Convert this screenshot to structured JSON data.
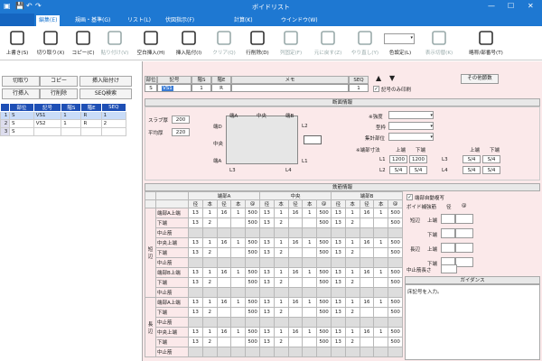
{
  "window": {
    "title": "ボイドリスト"
  },
  "menu": {
    "file": "",
    "tabs": [
      "編集(E)",
      "規画・基準(G)",
      "リスト(L)",
      "伏図指示(F)",
      "計算(K)",
      "ウインドウ(W)"
    ]
  },
  "ribbon": [
    {
      "label": "上書き(S)",
      "icon": "save-icon",
      "dis": false
    },
    {
      "label": "切り取り(X)",
      "icon": "cut-icon",
      "dis": false
    },
    {
      "label": "コピー(C)",
      "icon": "copy-icon",
      "dis": false
    },
    {
      "label": "貼り付け(V)",
      "icon": "paste-icon",
      "dis": true
    },
    {
      "label": "空白挿入(H)",
      "icon": "insert-blank-icon",
      "dis": false
    },
    {
      "label": "挿入貼付(I)",
      "icon": "insert-paste-icon",
      "dis": false
    },
    {
      "label": "クリア(Q)",
      "icon": "clear-icon",
      "dis": true
    },
    {
      "label": "行削除(D)",
      "icon": "delete-row-icon",
      "dis": false
    },
    {
      "label": "列固定(F)",
      "icon": "freeze-column-icon",
      "dis": true
    },
    {
      "label": "元に戻す(Z)",
      "icon": "undo-icon",
      "dis": true
    },
    {
      "label": "やり直し(Y)",
      "icon": "redo-icon",
      "dis": true
    },
    {
      "label": "色設定(L)",
      "icon": "color-setting-icon",
      "dis": false
    },
    {
      "label": "表示切替(K)",
      "icon": "display-toggle-icon",
      "dis": true
    },
    {
      "label": "略称/部番号(T)",
      "icon": "abbreviation-icon",
      "dis": false
    }
  ],
  "leftbuttons": [
    "切取り",
    "コピー",
    "挿入貼付け",
    "行挿入",
    "行削除",
    "SEQ検索"
  ],
  "list": {
    "headers": [
      "部位",
      "記号",
      "階S",
      "階E",
      "SEQ"
    ],
    "rows": [
      [
        "1",
        "S",
        "VS1",
        "1",
        "R",
        "1"
      ],
      [
        "2",
        "S",
        "VS2",
        "1",
        "R",
        "2"
      ],
      [
        "3",
        "S",
        "",
        "",
        "",
        ""
      ]
    ]
  },
  "top": {
    "headers": [
      "部位",
      "記号",
      "階S",
      "階E",
      "メモ",
      "SEQ"
    ],
    "buhi": "S",
    "kigo": "VS1",
    "kais": "1",
    "kaie": "R",
    "seq": "1",
    "print_label": "記号のみ印刷",
    "other_btn": "その他節数"
  },
  "section": {
    "title": "断面情報",
    "slab_label": "スラブ厚",
    "slab": "200",
    "avg_label": "平均厚",
    "avg": "220",
    "diag_top": [
      "端A",
      "中央",
      "端B"
    ],
    "diag_left": [
      "端D",
      "中央",
      "端A"
    ],
    "L2": "L2",
    "L1": "L1",
    "L3": "L3",
    "L4": "L4",
    "kyodo": "※強度",
    "kata": "型枠",
    "shuukei": "集計部位",
    "sunpo": "※端部寸法",
    "jotan": "上端",
    "katan": "下端",
    "L1v": [
      "1200",
      "1200"
    ],
    "L2v": [
      "S/4",
      "S/4"
    ],
    "L3v": [
      "S/4",
      "S/4"
    ],
    "L4v": [
      "S/4",
      "S/4"
    ]
  },
  "rebar": {
    "title": "鉄筋情報",
    "groups": [
      "端部A",
      "中央",
      "端部B"
    ],
    "subh": [
      "径",
      "本",
      "径",
      "本",
      "@"
    ],
    "sections": [
      {
        "name": "短辺",
        "rows": [
          {
            "label": "端部A上端",
            "v": [
              "13",
              "1",
              "16",
              "1",
              "500",
              "13",
              "1",
              "16",
              "1",
              "500",
              "13",
              "1",
              "16",
              "1",
              "500"
            ]
          },
          {
            "label": "下端",
            "v": [
              "13",
              "2",
              "",
              "",
              "500",
              "13",
              "2",
              "",
              "",
              "500",
              "13",
              "2",
              "",
              "",
              "500"
            ]
          },
          {
            "label": "中止筋",
            "v": [
              "",
              "",
              "",
              "",
              "",
              "",
              "",
              "",
              "",
              "",
              "",
              "",
              "",
              "",
              ""
            ]
          },
          {
            "label": "中央上端",
            "v": [
              "13",
              "1",
              "16",
              "1",
              "500",
              "13",
              "1",
              "16",
              "1",
              "500",
              "13",
              "1",
              "16",
              "1",
              "500"
            ]
          },
          {
            "label": "下端",
            "v": [
              "13",
              "2",
              "",
              "",
              "500",
              "13",
              "2",
              "",
              "",
              "500",
              "13",
              "2",
              "",
              "",
              "500"
            ]
          },
          {
            "label": "中止筋",
            "v": [
              "",
              "",
              "",
              "",
              "",
              "",
              "",
              "",
              "",
              "",
              "",
              "",
              "",
              "",
              ""
            ]
          },
          {
            "label": "端部B上端",
            "v": [
              "13",
              "1",
              "16",
              "1",
              "500",
              "13",
              "1",
              "16",
              "1",
              "500",
              "13",
              "1",
              "16",
              "1",
              "500"
            ]
          },
          {
            "label": "下端",
            "v": [
              "13",
              "2",
              "",
              "",
              "500",
              "13",
              "2",
              "",
              "",
              "500",
              "13",
              "2",
              "",
              "",
              "500"
            ]
          },
          {
            "label": "中止筋",
            "v": [
              "",
              "",
              "",
              "",
              "",
              "",
              "",
              "",
              "",
              "",
              "",
              "",
              "",
              "",
              ""
            ]
          }
        ]
      },
      {
        "name": "長辺",
        "rows": [
          {
            "label": "端部A上端",
            "v": [
              "13",
              "1",
              "16",
              "1",
              "500",
              "13",
              "1",
              "16",
              "1",
              "500",
              "13",
              "1",
              "16",
              "1",
              "500"
            ]
          },
          {
            "label": "下端",
            "v": [
              "13",
              "2",
              "",
              "",
              "500",
              "13",
              "2",
              "",
              "",
              "500",
              "13",
              "2",
              "",
              "",
              "500"
            ]
          },
          {
            "label": "中止筋",
            "v": [
              "",
              "",
              "",
              "",
              "",
              "",
              "",
              "",
              "",
              "",
              "",
              "",
              "",
              "",
              ""
            ]
          },
          {
            "label": "中央上端",
            "v": [
              "13",
              "1",
              "16",
              "1",
              "500",
              "13",
              "1",
              "16",
              "1",
              "500",
              "13",
              "1",
              "16",
              "1",
              "500"
            ]
          },
          {
            "label": "下端",
            "v": [
              "13",
              "2",
              "",
              "",
              "500",
              "13",
              "2",
              "",
              "",
              "500",
              "13",
              "2",
              "",
              "",
              "500"
            ]
          },
          {
            "label": "中止筋",
            "v": [
              "",
              "",
              "",
              "",
              "",
              "",
              "",
              "",
              "",
              "",
              "",
              "",
              "",
              "",
              ""
            ]
          }
        ]
      }
    ]
  },
  "side": {
    "auto": "端部自動複写",
    "void": "ボイド補強筋",
    "kei": "径",
    "at": "@",
    "tanpen": "短辺",
    "uwa": "上端",
    "shita": "下端",
    "choupen": "長辺",
    "chushi": "中止筋長さ"
  },
  "guide": {
    "title": "ガイダンス",
    "text": "床記号を入力。"
  }
}
